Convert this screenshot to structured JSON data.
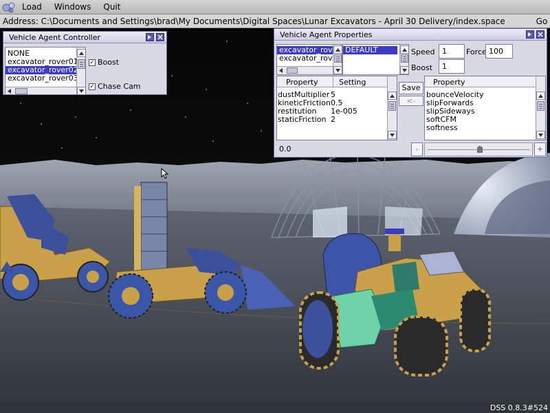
{
  "menubar": {
    "items": [
      "Load",
      "Windows",
      "Quit"
    ]
  },
  "addressbar": {
    "label": "Address: ",
    "value": "C:\\Documents and Settings\\brad\\My Documents\\Digital Spaces\\Lunar Excavators - April 30 Delivery/index.space",
    "go_label": "Go"
  },
  "controller": {
    "title": "Vehicle Agent Controller",
    "agents": [
      "NONE",
      "excavator_rover01",
      "excavator_rover02",
      "excavator_rover03"
    ],
    "selected": "excavator_rover02",
    "boost_label": "Boost",
    "boost_checked": true,
    "chasecam_label": "Chase Cam",
    "chasecam_checked": true
  },
  "properties": {
    "title": "Vehicle Agent Properties",
    "vehicles": [
      "excavator_rov",
      "excavator_rov"
    ],
    "vehicle_selected_index": 0,
    "profiles": [
      "DEFAULT"
    ],
    "speed_label": "Speed",
    "speed_value": "1",
    "force_label": "Force",
    "force_value": "100",
    "boost_label": "Boost",
    "boost_value": "1",
    "save_label": "Save",
    "move_label": "<-",
    "left_grid": {
      "col_property": "Property",
      "col_setting": "Setting",
      "rows": [
        {
          "property": "dustMultiplier",
          "setting": "5"
        },
        {
          "property": "kineticFriction",
          "setting": "0.5"
        },
        {
          "property": "restitution",
          "setting": "1e-005"
        },
        {
          "property": "staticFriction",
          "setting": "2"
        }
      ]
    },
    "right_grid": {
      "col_property": "Property",
      "rows": [
        "bounceVelocity",
        "slipForwards",
        "slipSideways",
        "softCFM",
        "softness"
      ]
    },
    "status_value": "0.0",
    "slider_minus": "-",
    "slider_plus": "+"
  },
  "version": "DSS 0.8.3#524"
}
